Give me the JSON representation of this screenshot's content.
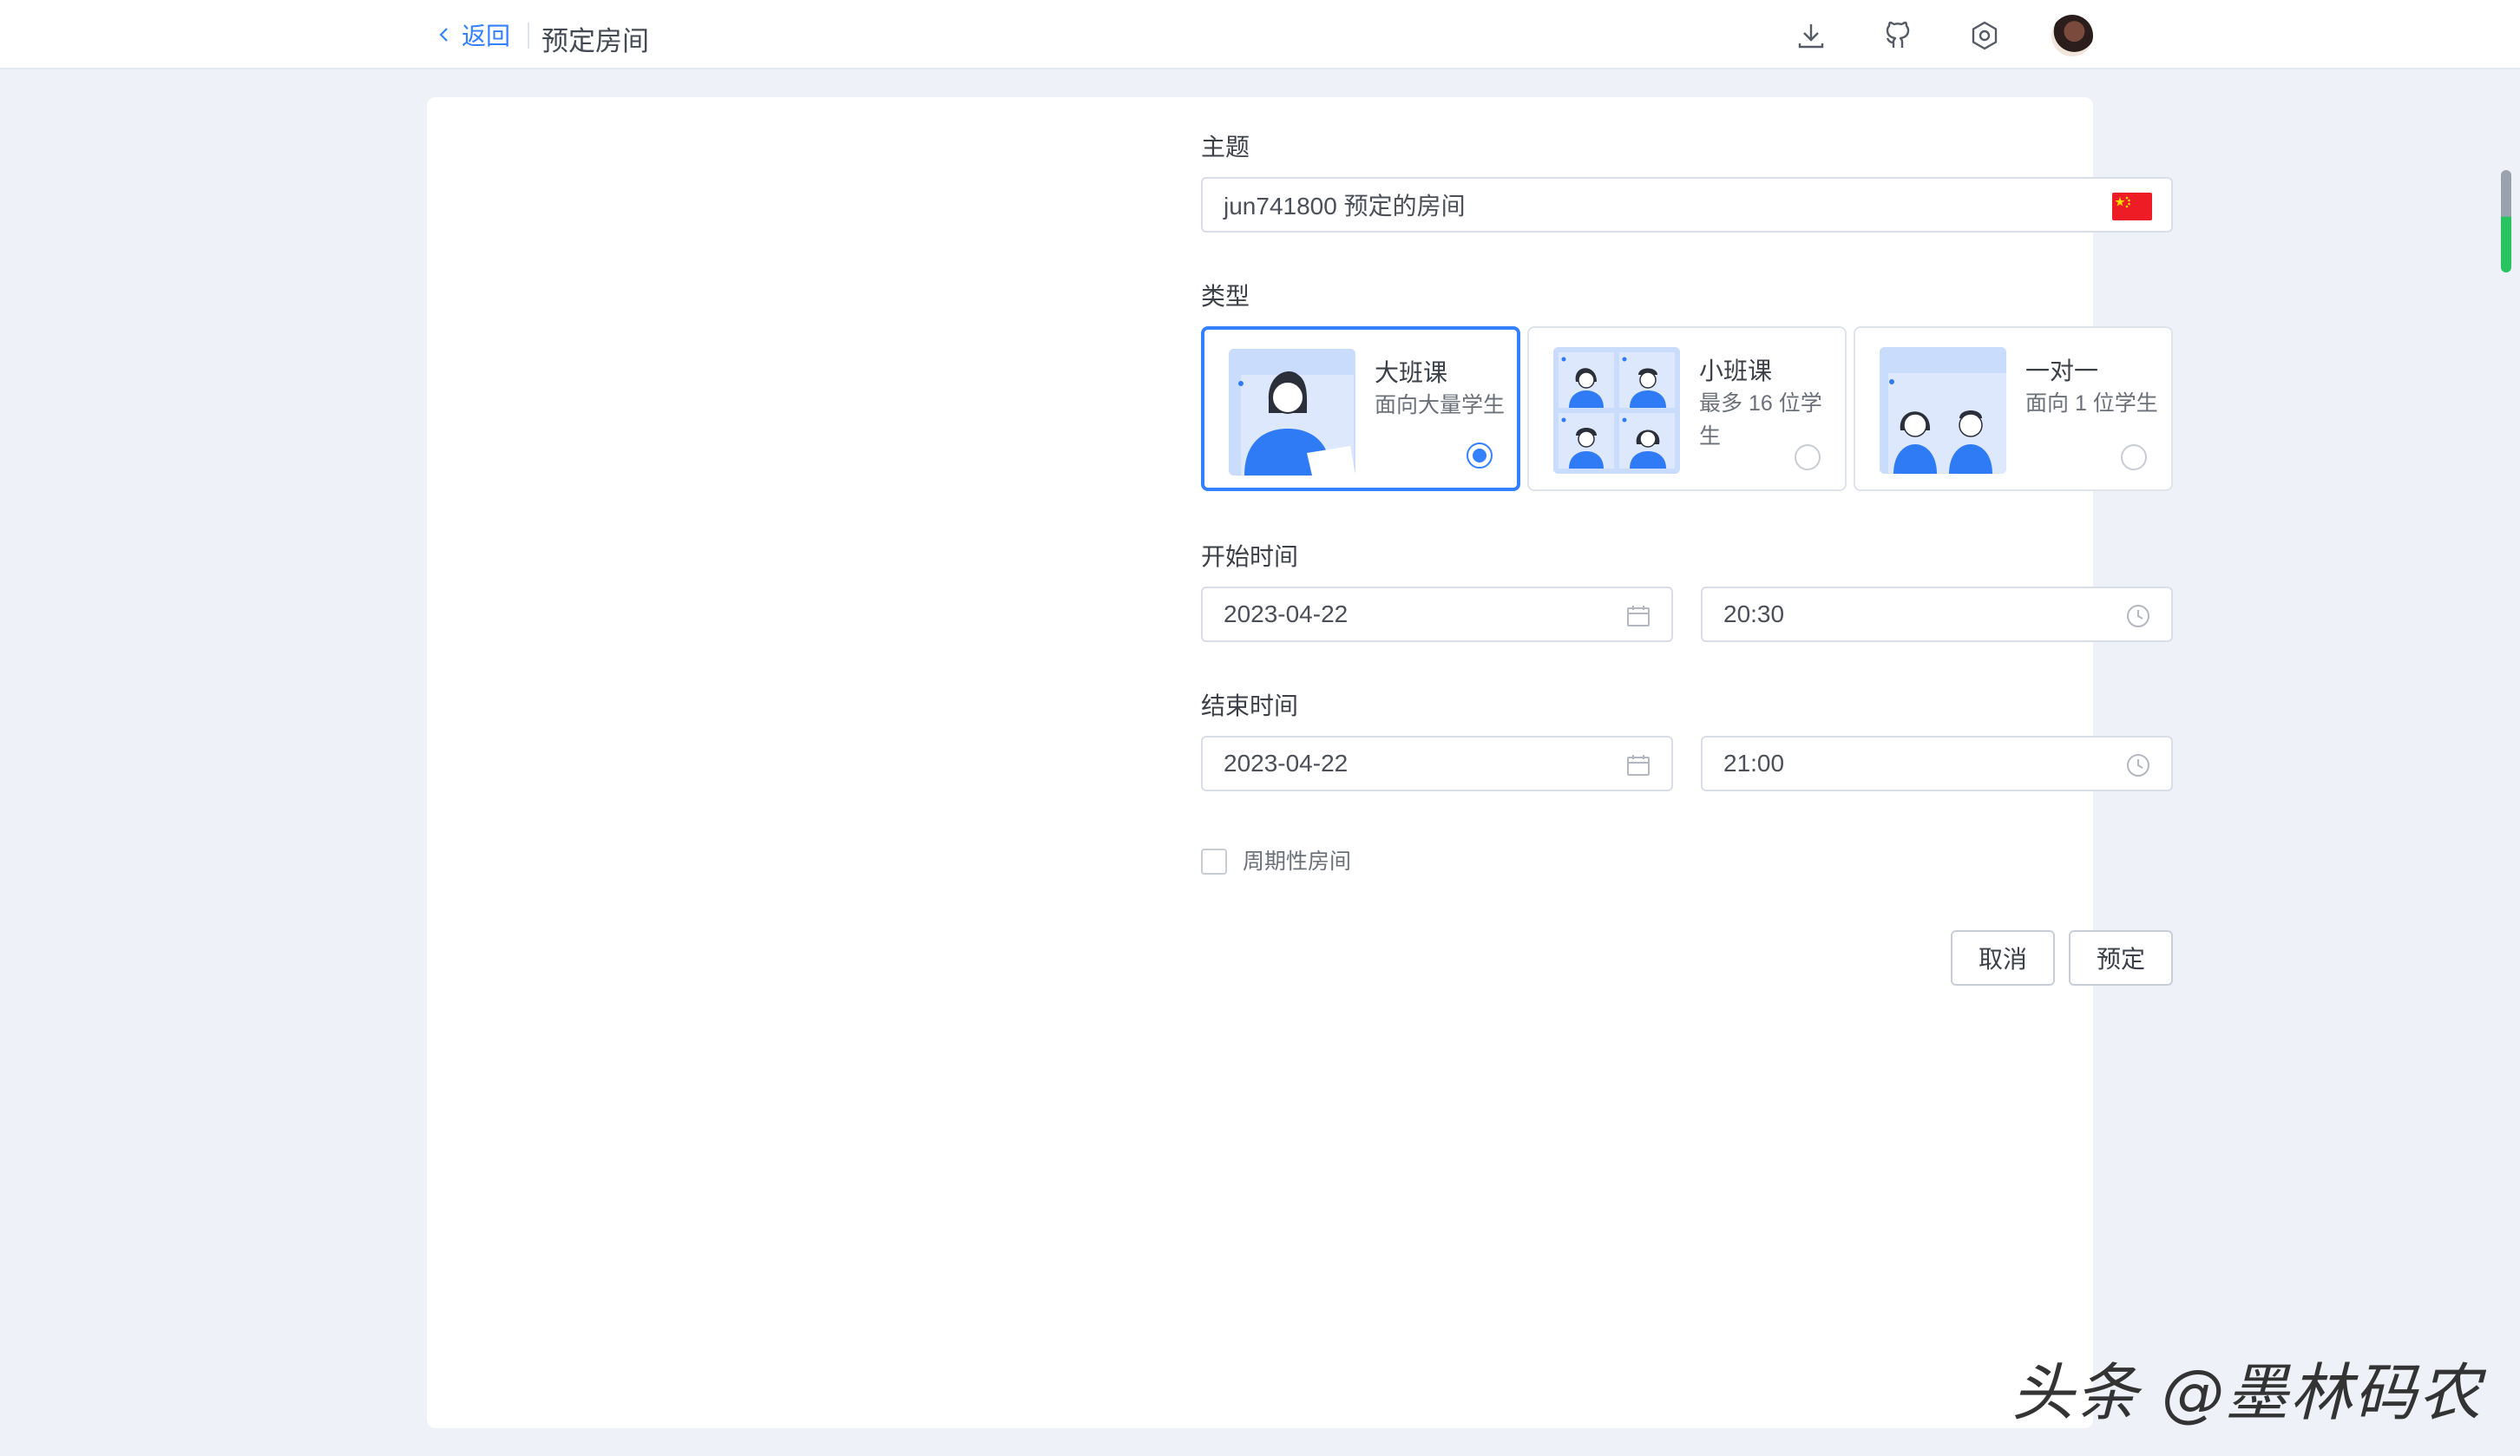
{
  "header": {
    "back_label": "返回",
    "page_title": "预定房间",
    "icons": [
      "download-icon",
      "github-icon",
      "settings-hexagon-icon",
      "user-avatar"
    ]
  },
  "form": {
    "subject": {
      "label": "主题",
      "value": "jun741800 预定的房间",
      "language_flag": "china-flag-icon"
    },
    "type": {
      "label": "类型",
      "options": [
        {
          "title": "大班课",
          "desc": "面向大量学生",
          "selected": true
        },
        {
          "title": "小班课",
          "desc": "最多 16 位学生",
          "selected": false
        },
        {
          "title": "一对一",
          "desc": "面向 1 位学生",
          "selected": false
        }
      ]
    },
    "start": {
      "label": "开始时间",
      "date": "2023-04-22",
      "time": "20:30"
    },
    "end": {
      "label": "结束时间",
      "date": "2023-04-22",
      "time": "21:00"
    },
    "periodic": {
      "label": "周期性房间",
      "checked": false
    },
    "buttons": {
      "cancel": "取消",
      "confirm": "预定"
    }
  },
  "watermark": "头条 @墨林码农",
  "colors": {
    "accent": "#3381ff",
    "background": "#eef1f7",
    "illustration_bg": "#c9dcfb",
    "illustration_figure": "#2f7bf5",
    "flag_red": "#ee1c25",
    "scroll_green": "#29c462"
  }
}
